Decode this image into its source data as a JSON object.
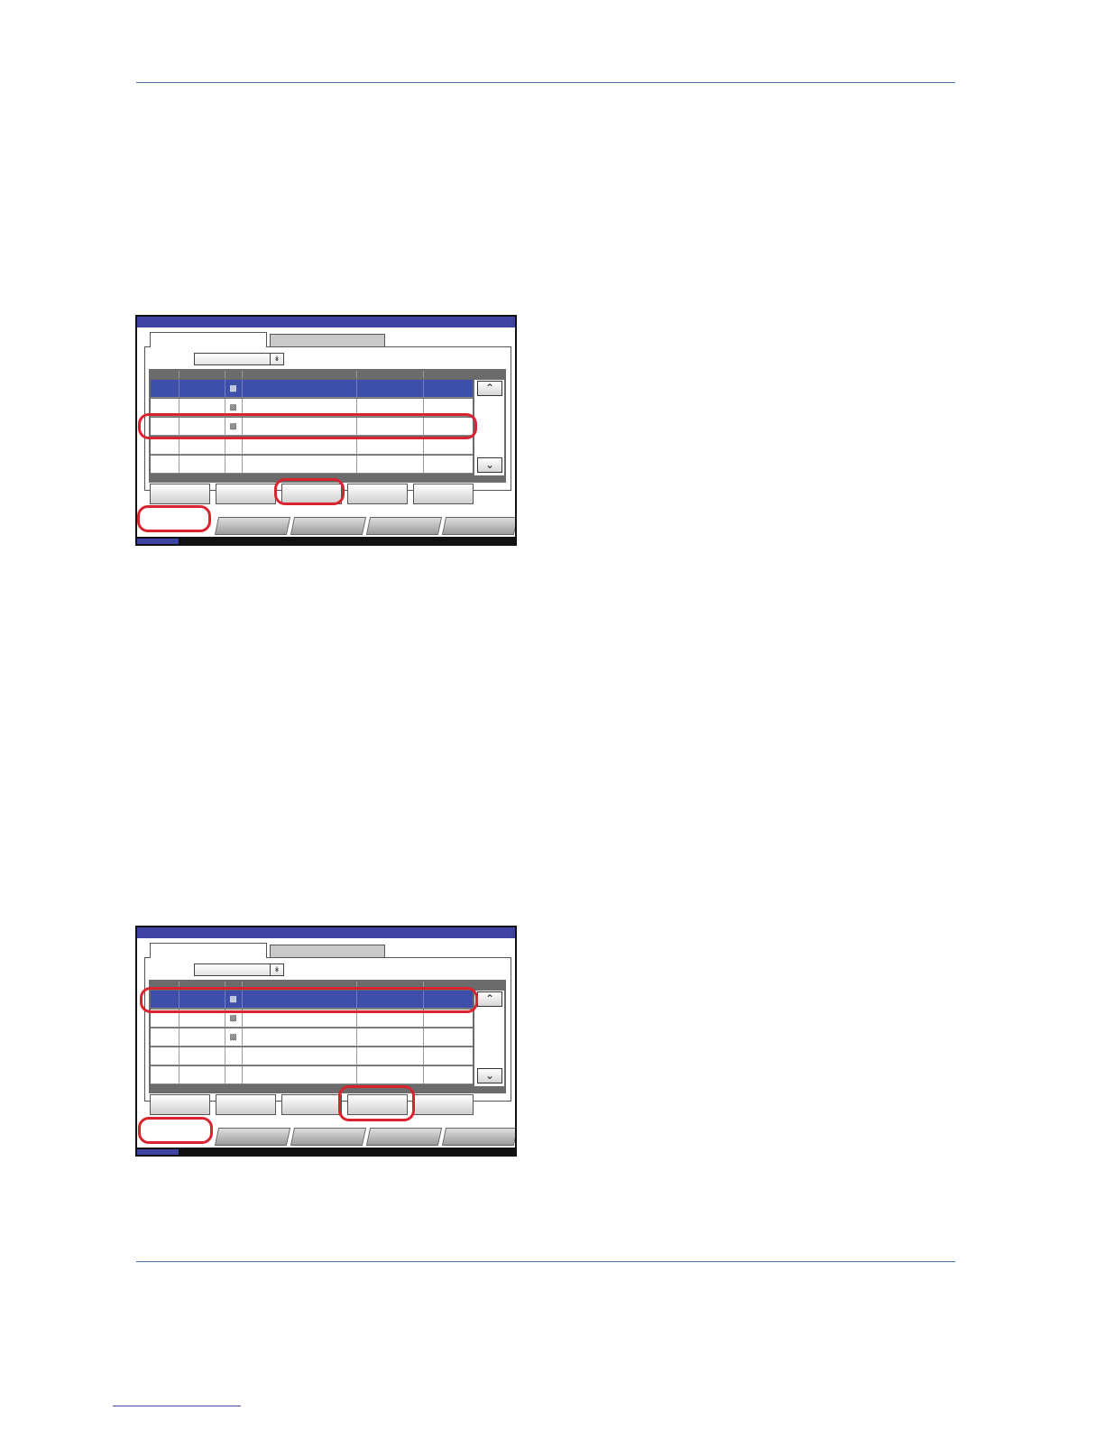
{
  "page": {
    "rules": [
      "header-rule",
      "footer-rule"
    ]
  },
  "figures": [
    {
      "name": "screen-1",
      "selected_row": 0,
      "highlighted_row": 2,
      "highlighted_button": 2,
      "highlight_home_tab": true,
      "rows": [
        {
          "has_icon": true
        },
        {
          "has_icon": true
        },
        {
          "has_icon": true
        },
        {
          "has_icon": false
        },
        {
          "has_icon": false
        }
      ],
      "buttons_count": 5
    },
    {
      "name": "screen-2",
      "selected_row": 0,
      "highlighted_row": 0,
      "highlighted_button": 3,
      "highlight_home_tab": true,
      "rows": [
        {
          "has_icon": true
        },
        {
          "has_icon": true
        },
        {
          "has_icon": true
        },
        {
          "has_icon": false
        },
        {
          "has_icon": false
        }
      ],
      "buttons_count": 5
    }
  ],
  "colors": {
    "accent": "#3f44a3",
    "highlight": "#d9232e",
    "rule": "#4a6fa5"
  },
  "icons": {
    "dropdown": "double-chevron-down-icon",
    "scroll_up": "chevron-up-icon",
    "scroll_down": "chevron-down-icon",
    "box": "box-icon"
  }
}
